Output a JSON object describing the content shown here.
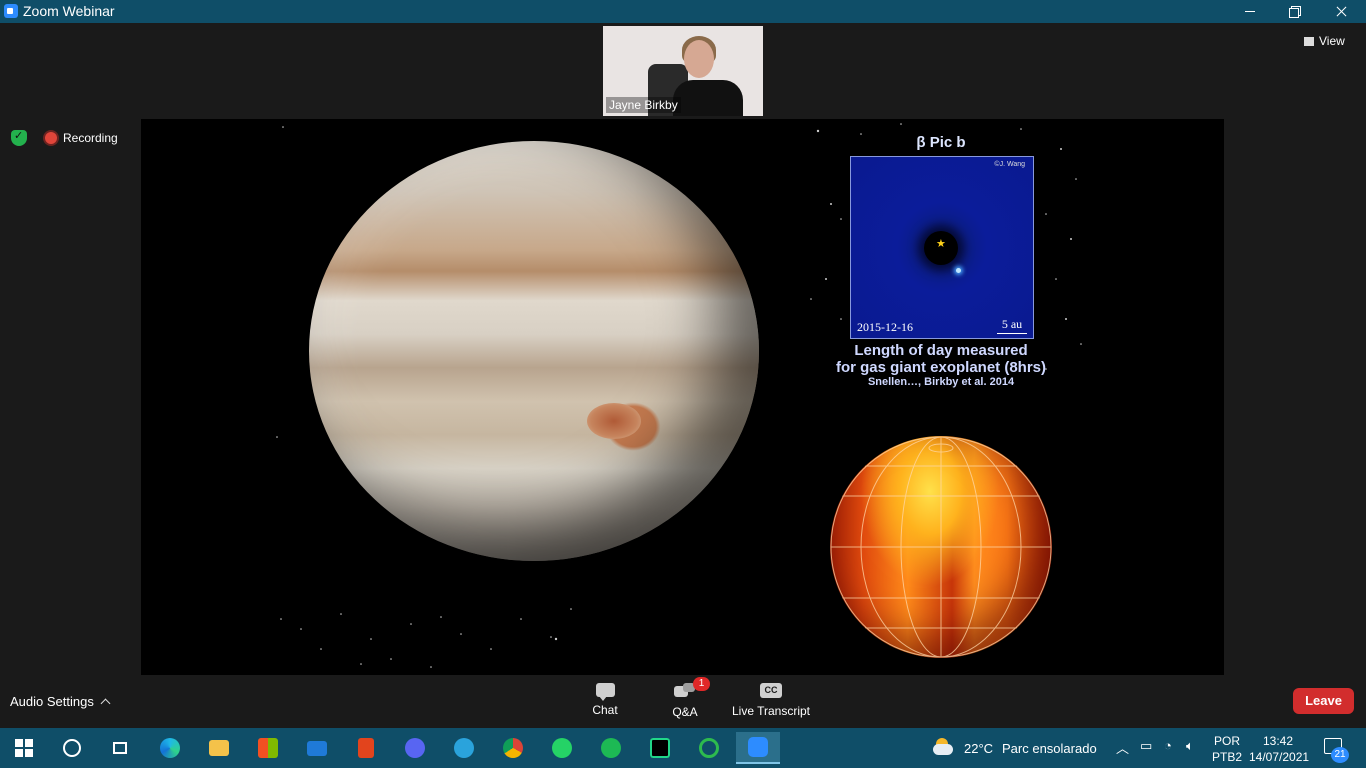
{
  "window": {
    "title": "Zoom Webinar",
    "minimize": "",
    "maximize": "",
    "close": ""
  },
  "speaker": {
    "name": "Jayne Birkby"
  },
  "view_button": {
    "label": "View"
  },
  "recording": {
    "label": "Recording"
  },
  "slide": {
    "panel_title": "β Pic b",
    "panel_credit": "©J. Wang",
    "panel_date": "2015-12-16",
    "panel_scale": "5 au",
    "caption_line1": "Length of day measured",
    "caption_line2": "for gas giant exoplanet (8hrs)",
    "citation": "Snellen…, Birkby et al. 2014"
  },
  "controls": {
    "audio_settings": "Audio Settings",
    "chat": "Chat",
    "qa": "Q&A",
    "qa_badge": "1",
    "live_transcript": "Live Transcript",
    "cc": "CC",
    "leave": "Leave"
  },
  "taskbar": {
    "apps": [
      "start",
      "search",
      "task-view",
      "edge",
      "file-explorer",
      "microsoft-store",
      "mail",
      "office",
      "discord",
      "telegram",
      "chrome",
      "whatsapp",
      "spotify",
      "pycharm",
      "other-app",
      "zoom"
    ],
    "weather_temp": "22°C",
    "weather_text": "Parc ensolarado",
    "language_line1": "POR",
    "language_line2": "PTB2",
    "time": "13:42",
    "date": "14/07/2021",
    "notification_count": "21"
  },
  "colors": {
    "titlebar": "#0f4e68",
    "leave": "#d22d2d",
    "badge": "#e02828",
    "zoom_blue": "#2d8cff"
  }
}
